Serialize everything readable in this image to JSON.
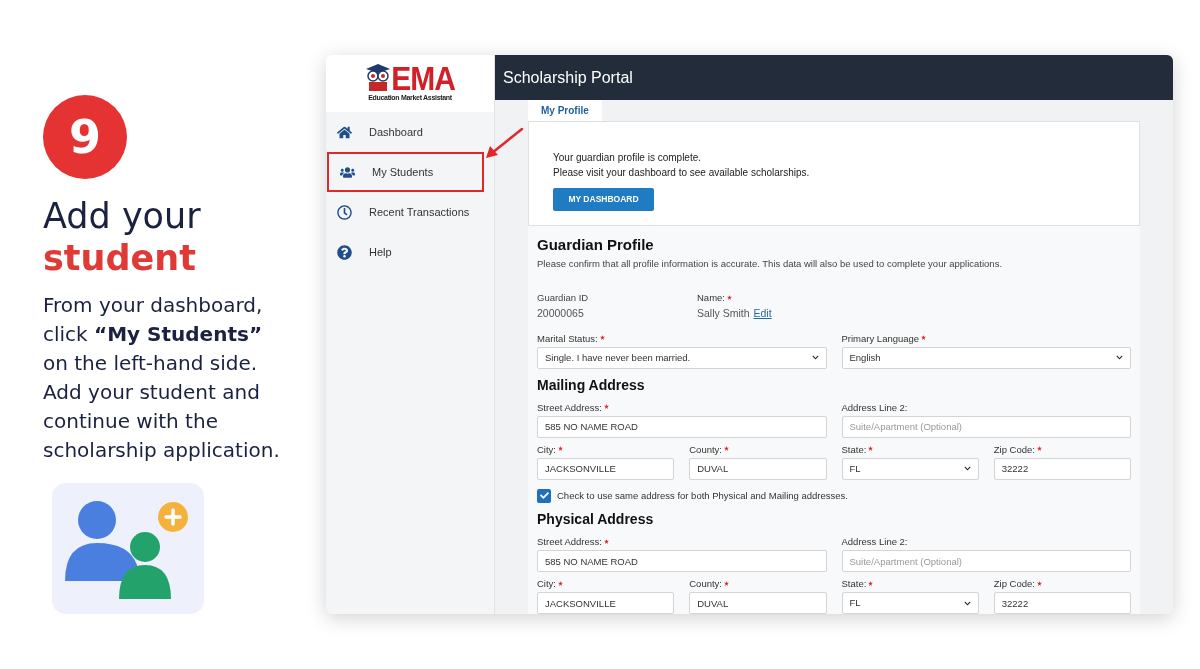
{
  "step": {
    "number": "9",
    "title": "Add your",
    "title_highlight": "student",
    "description": "From your dashboard, click **“My Students”** on the left-hand side. Add your student and continue with the scholarship application."
  },
  "app": {
    "logo": {
      "wordmark": "EMA",
      "tagline": "Education Market Assistant"
    },
    "header_title": "Scholarship Portal",
    "sidebar": [
      {
        "label": "Dashboard",
        "highlighted": false
      },
      {
        "label": "My Students",
        "highlighted": true
      },
      {
        "label": "Recent Transactions",
        "highlighted": false
      },
      {
        "label": "Help",
        "highlighted": false
      }
    ],
    "tabs": [
      {
        "label": "My Profile",
        "selected": true
      }
    ],
    "notice": {
      "lines": [
        "Your guardian profile is complete.",
        "Please visit your dashboard to see available scholarships."
      ],
      "button": "MY DASHBOARD"
    },
    "profile": {
      "title": "Guardian Profile",
      "subtitle": "Please confirm that all profile information is accurate. This data will also be used to complete your applications.",
      "id_label": "Guardian ID",
      "id_value": "20000065",
      "name_label": "Name:",
      "name_required": true,
      "name_value": "Sally Smith",
      "edit_link": "Edit"
    },
    "top_fields": [
      {
        "kind": "select",
        "label": "Marital Status:",
        "required": true,
        "value": "Single. I have never been married."
      },
      {
        "kind": "select",
        "label": "Primary Language",
        "required": true,
        "value": "English"
      }
    ],
    "sections": [
      {
        "title": "Mailing Address",
        "fields": [
          {
            "kind": "text",
            "label": "Street Address:",
            "required": true,
            "value": "585 NO NAME ROAD"
          },
          {
            "kind": "text",
            "label": "Address Line 2:",
            "required": false,
            "placeholder": "Suite/Apartment (Optional)"
          },
          {
            "kind": "text",
            "label": "City:",
            "required": true,
            "value": "JACKSONVILLE"
          },
          {
            "kind": "text",
            "label": "County:",
            "required": true,
            "value": "DUVAL"
          },
          {
            "kind": "select",
            "label": "State:",
            "required": true,
            "value": "FL"
          },
          {
            "kind": "text",
            "label": "Zip Code:",
            "required": true,
            "value": "32222"
          }
        ],
        "checkbox": {
          "label": "Check to use same address for both Physical and Mailing addresses.",
          "checked": true
        }
      },
      {
        "title": "Physical Address",
        "fields": [
          {
            "kind": "text",
            "label": "Street Address:",
            "required": true,
            "value": "585 NO NAME ROAD"
          },
          {
            "kind": "text",
            "label": "Address Line 2:",
            "required": false,
            "placeholder": "Suite/Apartment (Optional)"
          },
          {
            "kind": "text",
            "label": "City:",
            "required": true,
            "value": "JACKSONVILLE"
          },
          {
            "kind": "text",
            "label": "County:",
            "required": true,
            "value": "DUVAL"
          },
          {
            "kind": "select",
            "label": "State:",
            "required": true,
            "value": "FL"
          },
          {
            "kind": "text",
            "label": "Zip Code:",
            "required": true,
            "value": "32222"
          }
        ]
      }
    ]
  }
}
